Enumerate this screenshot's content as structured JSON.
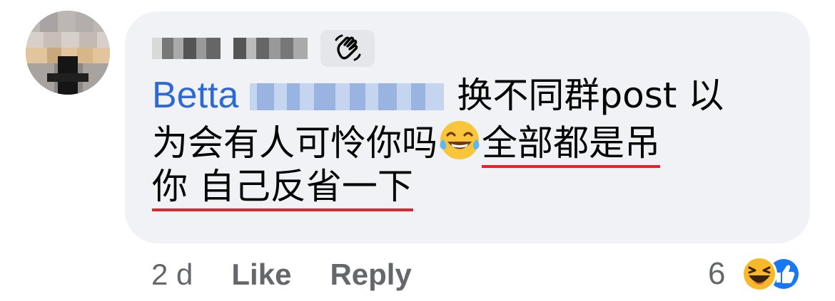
{
  "comment": {
    "mention_name": "Betta",
    "text_line1": "换不同群post 以",
    "text_line2_plain": "为会有人可怜你吗",
    "emoji_inline": "tears-of-joy-emoji",
    "text_line2_underlined": "全部都是吊",
    "text_line3_underlined": "你 自己反省一下",
    "badge_icon": "waving-hand-icon"
  },
  "actions": {
    "timestamp": "2 d",
    "like_label": "Like",
    "reply_label": "Reply"
  },
  "reactions": {
    "count": "6",
    "icons": [
      "haha-reaction-icon",
      "like-reaction-icon"
    ]
  },
  "colors": {
    "bubble": "#f0f2f5",
    "mention": "#2d6ad3",
    "underline": "#e0252a",
    "meta_text": "#65676b",
    "like_blue": "#1877f2"
  }
}
